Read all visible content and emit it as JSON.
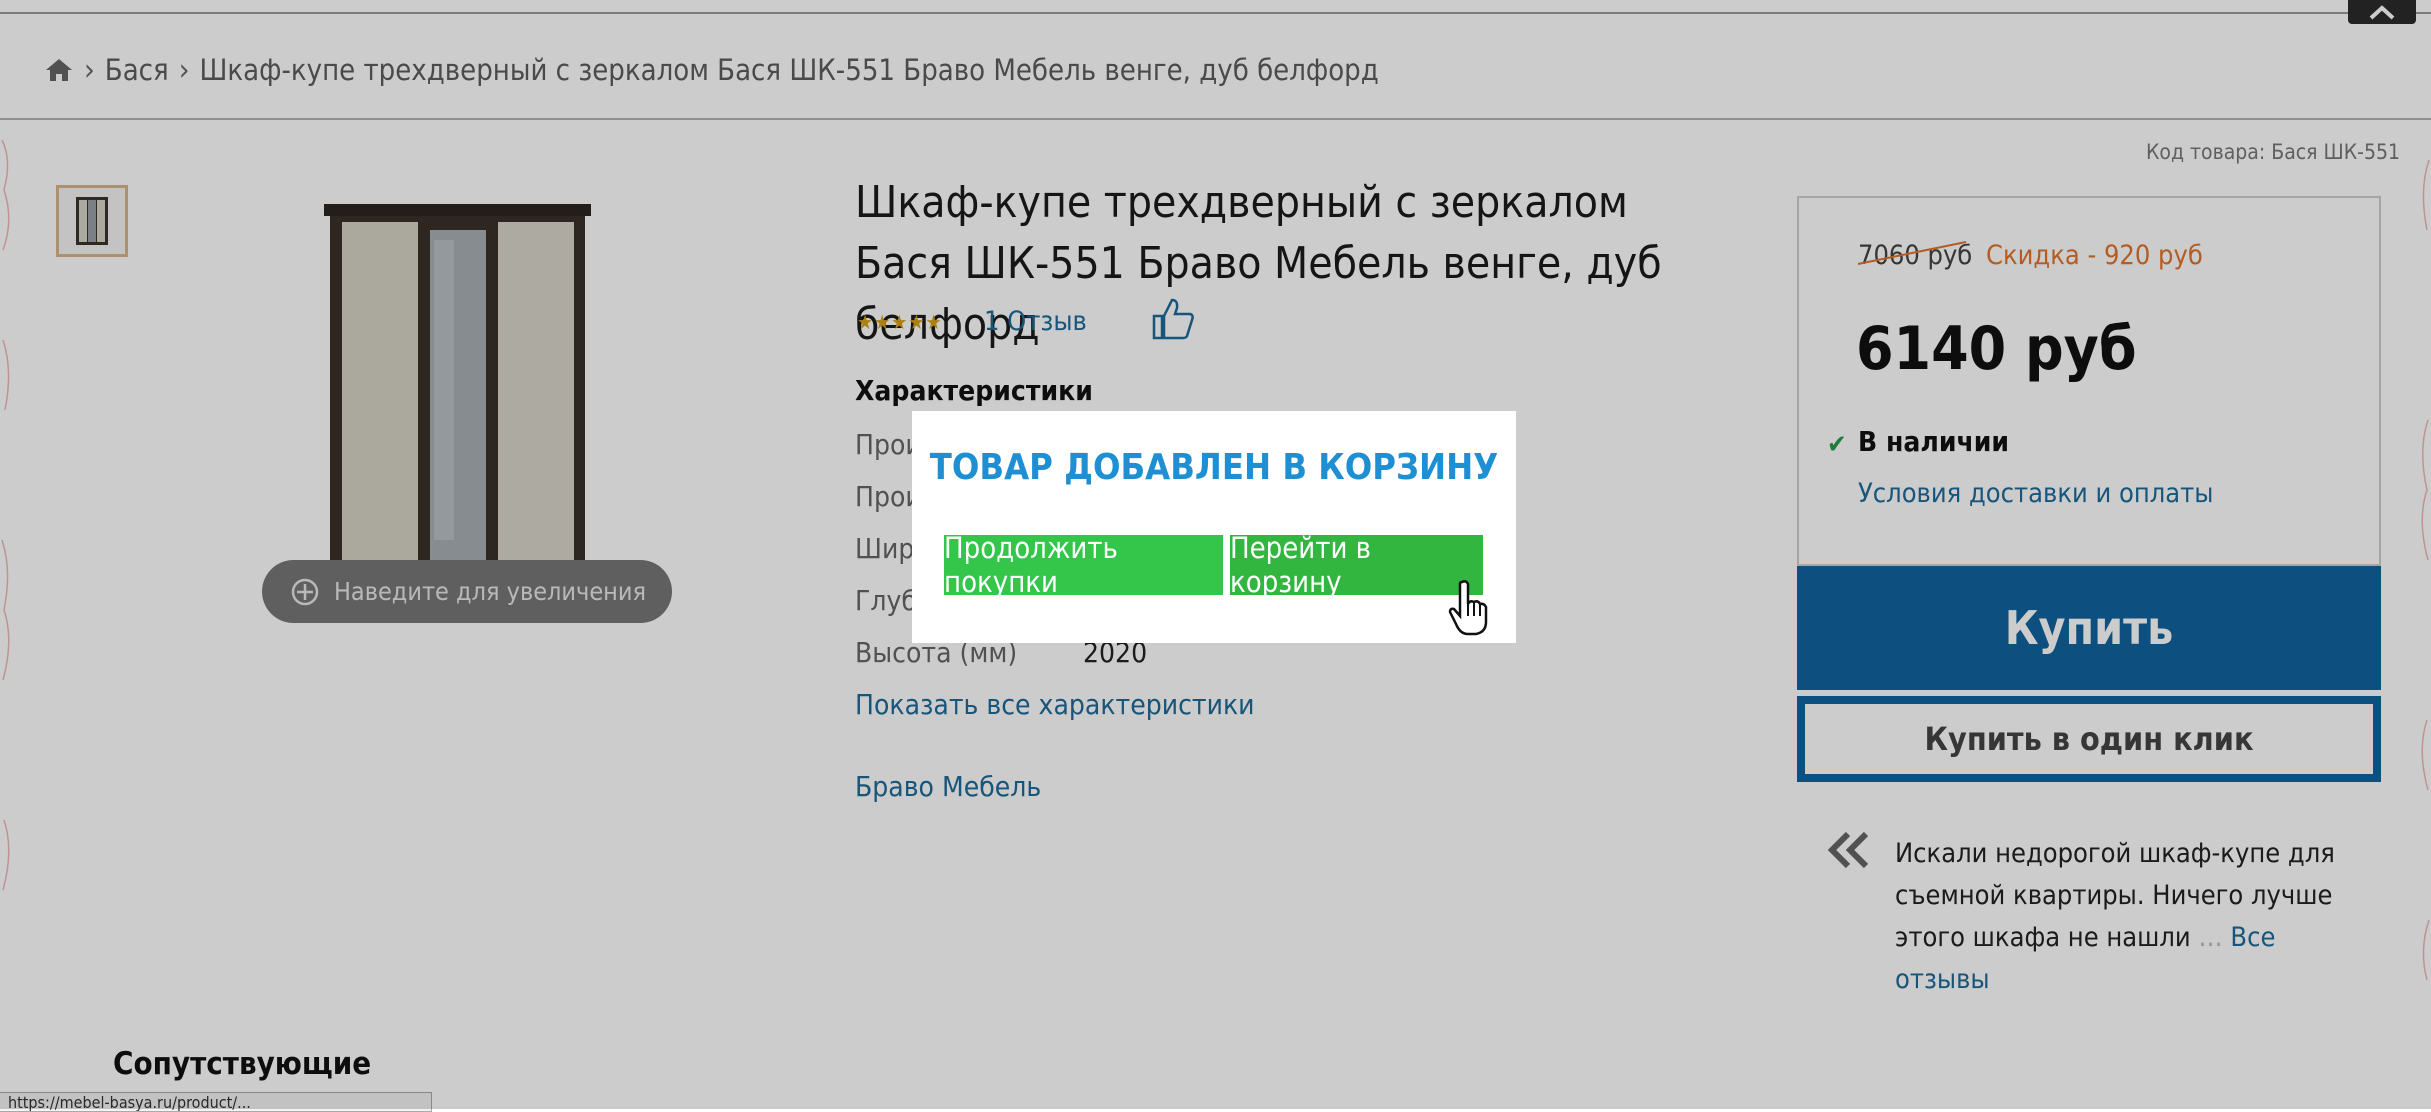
{
  "breadcrumb": {
    "items": [
      "Бася",
      "Шкаф-купе трехдверный с зеркалом Бася ШК-551 Браво Мебель венге, дуб белфорд"
    ]
  },
  "gallery": {
    "zoom_hint": "Наведите для увеличения"
  },
  "product": {
    "sku": "Код товара: Бася ШК-551",
    "title": "Шкаф-купе трехдверный с зеркалом Бася ШК-551 Браво Мебель венге, дуб белфорд",
    "reviews_link": "1 Отзыв",
    "characteristics_heading": "Характеристики",
    "characteristics": [
      {
        "label": "Прои",
        "value": ""
      },
      {
        "label": "Прои",
        "value": ""
      },
      {
        "label": "Шири",
        "value": ""
      },
      {
        "label": "Глуби",
        "value": ""
      },
      {
        "label": "Высота (мм)",
        "value": "2020"
      }
    ],
    "show_all": "Показать все характеристики",
    "brand": "Браво Мебель"
  },
  "pricing": {
    "old_price": "7060 руб",
    "discount": "Скидка - 920 руб",
    "price": "6140 руб",
    "stock": "В наличии",
    "delivery_link": "Условия доставки и оплаты",
    "buy_label": "Купить",
    "one_click_label": "Купить в один клик"
  },
  "review": {
    "text": "Искали недорогой шкаф-купе для съемной квартиры. Ничего лучше этого шкафа не нашли",
    "more": "Все отзывы"
  },
  "related_heading": "Сопутствующие",
  "status_url": "https://mebel-basya.ru/product/...",
  "modal": {
    "title": "ТОВАР ДОБАВЛЕН В КОРЗИНУ",
    "continue_label": "Продолжить покупки",
    "cart_label": "Перейти в корзину"
  },
  "colors": {
    "accent_blue": "#11659f",
    "link_blue": "#1d6b9a",
    "modal_green": "#33c64a",
    "discount_orange": "#e0742e"
  }
}
